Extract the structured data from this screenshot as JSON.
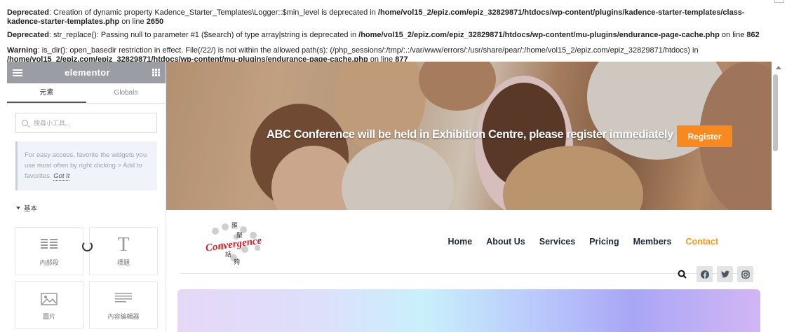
{
  "warnings": [
    {
      "level": "Deprecated",
      "text": ": Creation of dynamic property Kadence_Starter_Templates\\Logger::$min_level is deprecated in ",
      "path": "/home/vol15_2/epiz.com/epiz_32829871/htdocs/wp-content/plugins/kadence-starter-templates/class-kadence-starter-templates.php",
      "on_line": " on line ",
      "line": "2650"
    },
    {
      "level": "Deprecated",
      "text": ": str_replace(): Passing null to parameter #1 ($search) of type array|string is deprecated in ",
      "path": "/home/vol15_2/epiz.com/epiz_32829871/htdocs/wp-content/mu-plugins/endurance-page-cache.php",
      "on_line": " on line ",
      "line": "862"
    },
    {
      "level": "Warning",
      "text": ": is_dir(): open_basedir restriction in effect. File(/22/) is not within the allowed path(s): (/php_sessions/:/tmp/:.:/var/www/errors/:/usr/share/pear/:/home/vol15_2/epiz.com/epiz_32829871/htdocs) in ",
      "path": "/home/vol15_2/epiz.com/epiz_32829871/htdocs/wp-content/mu-plugins/endurance-page-cache.php",
      "on_line": " on line ",
      "line": "877"
    }
  ],
  "panel": {
    "logo": "elementor",
    "tabs": [
      "元素",
      "Globals"
    ],
    "search_placeholder": "搜尋小工具...",
    "tip_text": "For easy access, favorite the widgets you use most often by right clicking > Add to favorites.",
    "tip_link": "Got It",
    "section_title": "基本",
    "widgets": [
      {
        "label": "內部段",
        "icon": "inner-section-icon"
      },
      {
        "label": "標題",
        "icon": "heading-icon"
      },
      {
        "label": "圖片",
        "icon": "image-icon"
      },
      {
        "label": "內容編輯器",
        "icon": "text-editor-icon"
      }
    ]
  },
  "hero": {
    "text": "ABC Conference will be held in Exhibition Centre, please register immediately",
    "button": "Register",
    "button_color": "#f7891e"
  },
  "logo": {
    "word": "Convergence",
    "chars": [
      "匯",
      "聚",
      "話",
      "夠"
    ]
  },
  "nav": {
    "items": [
      "Home",
      "About Us",
      "Services",
      "Pricing",
      "Members",
      "Contact"
    ],
    "active_color": "#f39c1d"
  },
  "social": [
    "facebook-icon",
    "twitter-icon",
    "instagram-icon"
  ]
}
